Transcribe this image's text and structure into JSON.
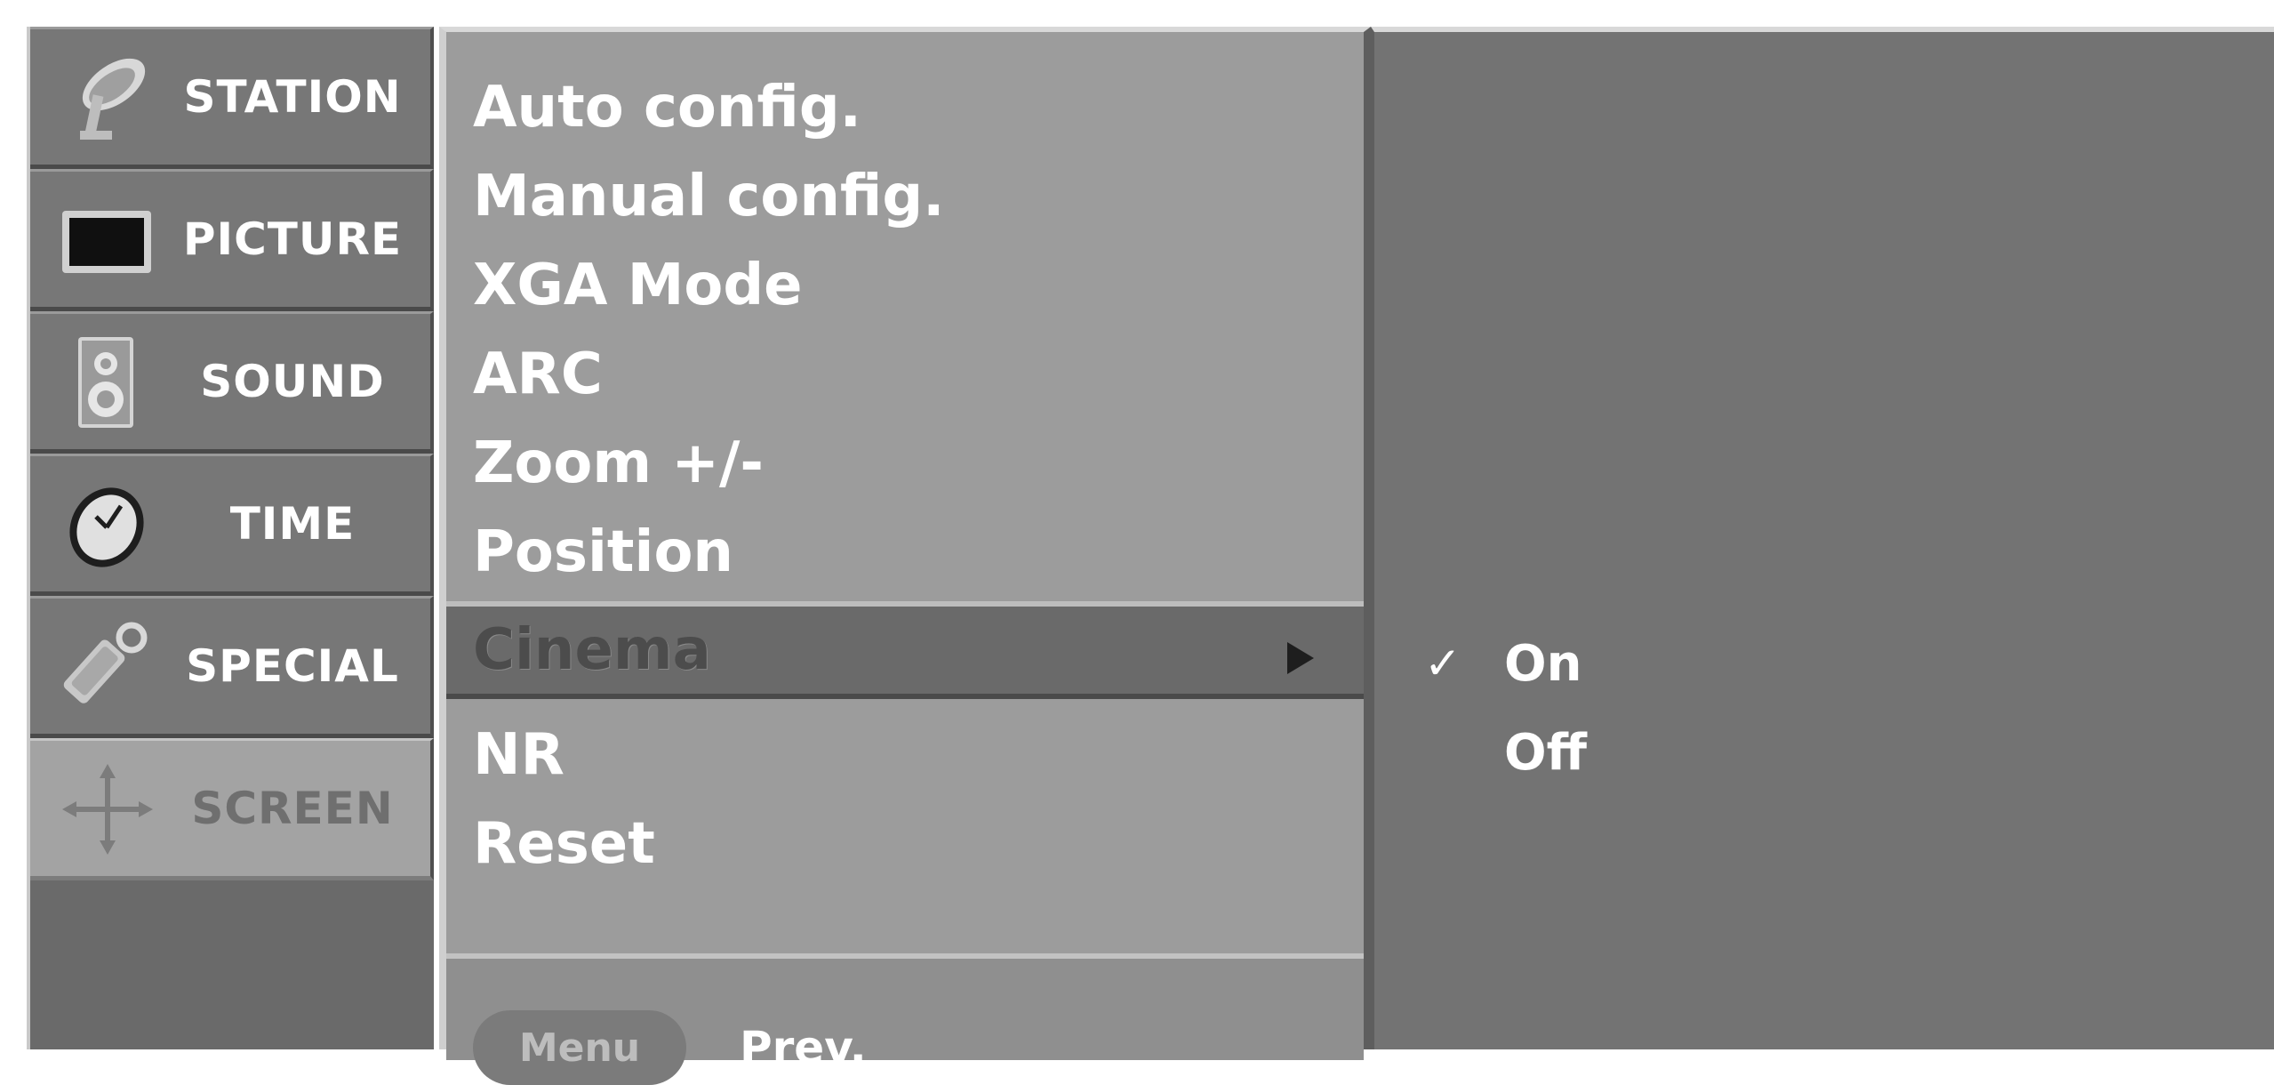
{
  "categories": [
    {
      "label": "STATION",
      "icon": "satellite-dish-icon",
      "selected": false
    },
    {
      "label": "PICTURE",
      "icon": "monitor-icon",
      "selected": false
    },
    {
      "label": "SOUND",
      "icon": "speaker-icon",
      "selected": false
    },
    {
      "label": "TIME",
      "icon": "clock-icon",
      "selected": false
    },
    {
      "label": "SPECIAL",
      "icon": "key-tag-icon",
      "selected": false
    },
    {
      "label": "SCREEN",
      "icon": "move-arrows-icon",
      "selected": true
    }
  ],
  "submenu": {
    "items": [
      "Auto config.",
      "Manual config.",
      "XGA Mode",
      "ARC",
      "Zoom +/-",
      "Position",
      "Cinema",
      "NR",
      "Reset"
    ],
    "highlighted_index": 6,
    "highlighted_arrow": "right-arrow-icon"
  },
  "footer": {
    "menu_button": "Menu",
    "prev_label": "Prev."
  },
  "options": {
    "items": [
      {
        "label": "On",
        "checked": true
      },
      {
        "label": "Off",
        "checked": false
      }
    ],
    "check_mark": "✓"
  },
  "colors": {
    "background": "#ffffff",
    "panel_dark": "#737373",
    "panel_mid": "#9c9c9c",
    "highlight": "#6a6a6a",
    "text": "#ffffff"
  }
}
